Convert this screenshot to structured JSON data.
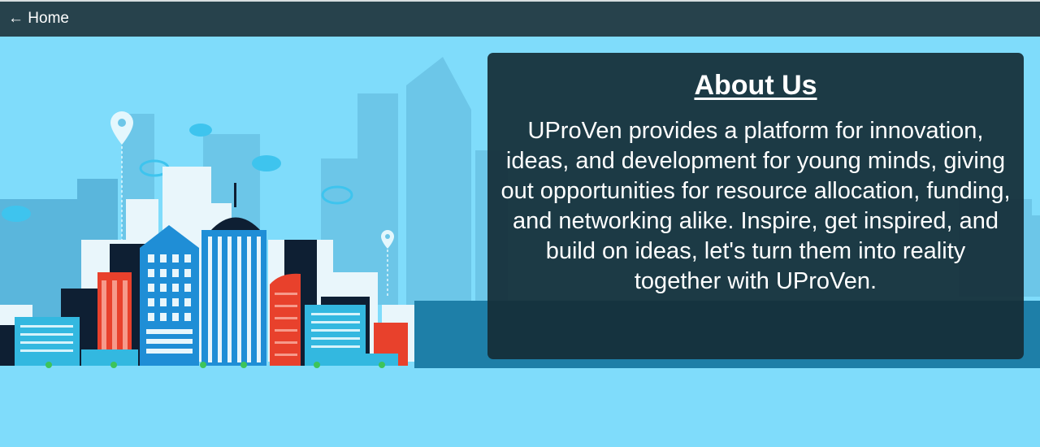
{
  "nav": {
    "home_link": "← Home"
  },
  "about": {
    "title": "About Us",
    "body": "UProVen provides a platform for innovation, ideas, and development for young minds, giving out opportunities for resource allocation, funding, and networking alike. Inspire, get inspired, and build on ideas, let's turn them into reality together with UProVen."
  },
  "colors": {
    "topbar": "#27424c",
    "sky": "#7fdcfb",
    "card": "#142d37",
    "accent_red": "#e8412c",
    "accent_blue": "#1f8ed6"
  },
  "icons": [
    "map-pin-icon",
    "cloud-icon"
  ]
}
